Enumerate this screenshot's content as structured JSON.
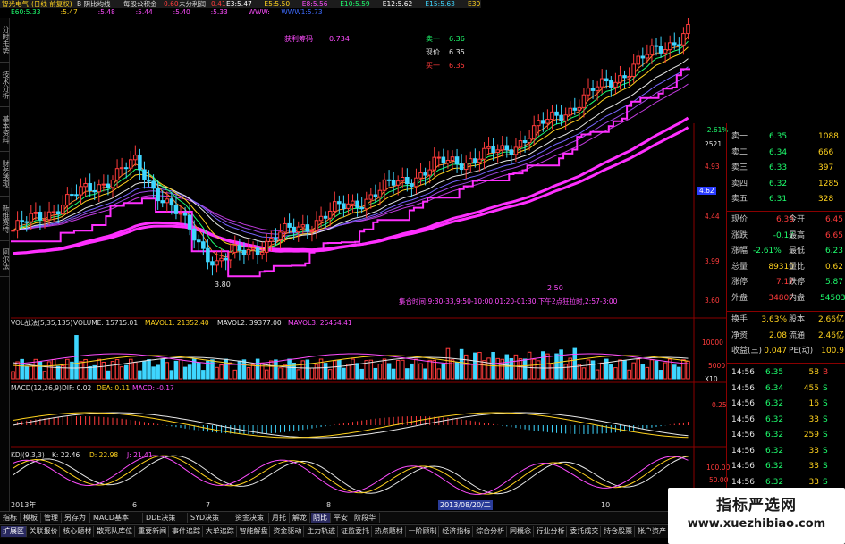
{
  "header": {
    "stock": "智光电气",
    "period": "(日线 前复权)",
    "mode": "B 阴比均线",
    "per_share": "每股公积金",
    "per_share_value": "0.60",
    "undistributed": "未分利润",
    "undistributed_value": "0.41",
    "ma": [
      {
        "label": "E3:5.47",
        "color": "#ffffff"
      },
      {
        "label": "E5:5.50",
        "color": "#ffd21e"
      },
      {
        "label": "E8:5.56",
        "color": "#ff4dff"
      },
      {
        "label": "E10:5.59",
        "color": "#1eff6e"
      },
      {
        "label": "E12:5.62",
        "color": "#ffffff"
      },
      {
        "label": "E15:5.63",
        "color": "#3ed6ff"
      },
      {
        "label": "E30:5",
        "color": "#ffd21e"
      }
    ],
    "ma2": [
      {
        "label": "E60:5.33",
        "color": "#1eff6e"
      },
      {
        "label": ":5.47",
        "color": "#ffd21e"
      },
      {
        "label": ":5.48",
        "color": "#ff4dff"
      },
      {
        "label": ":5.44",
        "color": "#ff4dff"
      },
      {
        "label": ":5.40",
        "color": "#ff4dff"
      },
      {
        "label": ":5.33",
        "color": "#ff4dff"
      },
      {
        "label": "WWW:",
        "color": "#ff4dff"
      },
      {
        "label": "WWW1:5.73",
        "color": "#3e6bff"
      }
    ]
  },
  "annotations": {
    "profit_label": "获利筹码",
    "profit_value": "0.734",
    "sell1_label": "卖一",
    "sell1_value": "6.36",
    "now_label": "现价",
    "now_value": "6.35",
    "buy1_label": "买一",
    "buy1_value": "6.35",
    "low_marker": "3.80",
    "mid_marker": "2.50",
    "time_note": "集合时间:9:30-33,9:50-10:00,01:20-01:30,下午2点狂拉时,2:57-3:00"
  },
  "price_axis": {
    "labels": [
      "-2.61%",
      "2521",
      "4.93",
      "4.62",
      "4.44",
      "3.99",
      "3.60"
    ]
  },
  "volume_panel": {
    "title": "VOL战法(5,35,135)",
    "vol": "VOLUME: 15715.01",
    "mavol1": "MAVOL1: 21352.40",
    "mavol2": "MAVOL2: 39377.00",
    "mavol3": "MAVOL3: 25454.41",
    "axis": [
      "10000",
      "5000",
      "X10"
    ]
  },
  "macd_panel": {
    "title": "MACD(12,26,9)",
    "dif": "DIF: 0.02",
    "dea": "DEA: 0.11",
    "macd": "MACD: -0.17",
    "axis": [
      "0.25"
    ]
  },
  "kdj_panel": {
    "title": "KDJ(9,3,3)",
    "k": "K: 22.46",
    "d": "D: 22.98",
    "j": "J: 21.41",
    "axis": [
      "100.00",
      "50.00"
    ]
  },
  "x_axis": {
    "labels": [
      "2013年",
      "6",
      "7",
      "8",
      "2013/08/20/二",
      "10"
    ]
  },
  "left_tabs": [
    "分时走势",
    "技术分析",
    "基本资料",
    "财务透视",
    "新维赛特",
    "阿尔法"
  ],
  "orderbook": {
    "asks": [
      {
        "label": "卖一",
        "price": "6.35",
        "vol": "1088"
      },
      {
        "label": "卖二",
        "price": "6.34",
        "vol": "666"
      },
      {
        "label": "卖三",
        "price": "6.33",
        "vol": "397"
      },
      {
        "label": "卖四",
        "price": "6.32",
        "vol": "1285"
      },
      {
        "label": "卖五",
        "price": "6.31",
        "vol": "328"
      }
    ],
    "quote": [
      {
        "l1": "现价",
        "v1": "6.35",
        "l2": "今开",
        "v2": "6.45",
        "c1": "red",
        "c2": "red"
      },
      {
        "l1": "涨跌",
        "v1": "-0.17",
        "l2": "最高",
        "v2": "6.65",
        "c1": "grn",
        "c2": "red"
      },
      {
        "l1": "涨幅",
        "v1": "-2.61%",
        "l2": "最低",
        "v2": "6.23",
        "c1": "grn",
        "c2": "grn"
      },
      {
        "l1": "总量",
        "v1": "89310",
        "l2": "量比",
        "v2": "0.62",
        "c1": "yel",
        "c2": "yel"
      },
      {
        "l1": "涨停",
        "v1": "7.17",
        "l2": "跌停",
        "v2": "5.87",
        "c1": "red",
        "c2": "grn"
      },
      {
        "l1": "外盘",
        "v1": "34807",
        "l2": "内盘",
        "v2": "54503",
        "c1": "red",
        "c2": "grn"
      }
    ],
    "quote2": [
      {
        "l1": "换手",
        "v1": "3.63%",
        "l2": "股本",
        "v2": "2.66亿"
      },
      {
        "l1": "净资",
        "v1": "2.08",
        "l2": "流通",
        "v2": "2.46亿"
      },
      {
        "l1": "收益(三)",
        "v1": "0.047",
        "l2": "PE(动)",
        "v2": "100.9"
      }
    ]
  },
  "ticks": [
    {
      "time": "14:56",
      "price": "6.35",
      "vol": "58",
      "side": "B"
    },
    {
      "time": "14:56",
      "price": "6.34",
      "vol": "455",
      "side": "S"
    },
    {
      "time": "14:56",
      "price": "6.32",
      "vol": "16",
      "side": "S"
    },
    {
      "time": "14:56",
      "price": "6.32",
      "vol": "33",
      "side": "S"
    },
    {
      "time": "14:56",
      "price": "6.32",
      "vol": "259",
      "side": "S"
    },
    {
      "time": "14:56",
      "price": "6.32",
      "vol": "33",
      "side": "S"
    },
    {
      "time": "14:56",
      "price": "6.32",
      "vol": "33",
      "side": "S"
    },
    {
      "time": "14:56",
      "price": "6.32",
      "vol": "33",
      "side": "S"
    }
  ],
  "bottom_tabs": [
    "指标",
    "模板",
    "管理",
    "另存为",
    "MACD基本",
    "DDE决策",
    "SYD决策",
    "资金决策",
    "月托",
    "解龙",
    "阴比",
    "平安",
    "阶段华"
  ],
  "bottom_tabs2": [
    "扩展区",
    "关联报价",
    "核心题材",
    "散死队库位",
    "重要新闻",
    "事件追踪",
    "大单追踪",
    "智能解盘",
    "资金驱动",
    "主力轨迹",
    "证监委托",
    "热点题材",
    "一阶顾制",
    "经济指标",
    "综合分析",
    "同概念",
    "行业分析",
    "委托成交",
    "持仓股票",
    "帐户资产"
  ],
  "watermark": {
    "name": "指标严选网",
    "url": "www.xuezhibiao.com"
  },
  "colors": {
    "up": "#ff3b3b",
    "down": "#3ed6ff",
    "ma_magenta": "#ff2fff",
    "ma_yellow": "#ffd21e",
    "grid": "#8a0000"
  }
}
